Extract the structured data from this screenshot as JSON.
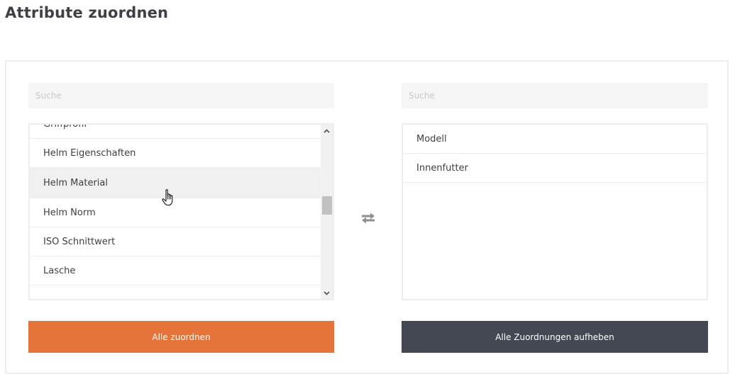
{
  "page": {
    "title": "Attribute zuordnen"
  },
  "available": {
    "search_placeholder": "Suche",
    "items": [
      {
        "label": "Griffprofil"
      },
      {
        "label": "Helm Eigenschaften"
      },
      {
        "label": "Helm Material",
        "hovered": true
      },
      {
        "label": "Helm Norm"
      },
      {
        "label": "ISO Schnittwert"
      },
      {
        "label": "Lasche"
      }
    ],
    "scroll_position": 0.45,
    "button_label": "Alle zuordnen"
  },
  "assigned": {
    "search_placeholder": "Suche",
    "items": [
      {
        "label": "Modell"
      },
      {
        "label": "Innenfutter"
      }
    ],
    "button_label": "Alle Zuordnungen aufheben"
  },
  "icons": {
    "swap": "swap-arrows-icon",
    "cursor": "hand-pointer-icon",
    "scroll_up": "chevron-up-icon",
    "scroll_down": "chevron-down-icon"
  },
  "colors": {
    "assign_button": "#e5743a",
    "unassign_button": "#434852",
    "hover_row": "#f0f0f0",
    "title": "#3f4046"
  }
}
